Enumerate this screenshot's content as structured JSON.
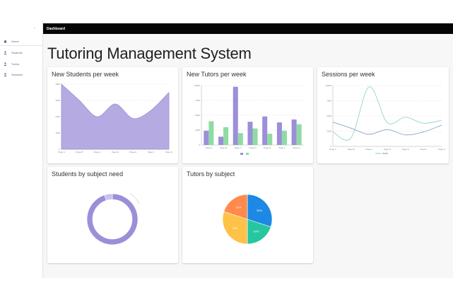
{
  "sidebar": {
    "collapse_icon": "chevron-left-icon",
    "items": [
      {
        "label": "Home",
        "icon": "home-icon"
      },
      {
        "label": "Students",
        "icon": "person-icon"
      },
      {
        "label": "Tutors",
        "icon": "person-icon"
      },
      {
        "label": "Sessions",
        "icon": "person-icon"
      }
    ]
  },
  "appbar": {
    "title": "Dashboard"
  },
  "page": {
    "title": "Tutoring Management System"
  },
  "colors": {
    "purple": "#9c8fd8",
    "green": "#8fdba3",
    "blue_line": "#7b92c8",
    "teal_line": "#8ad0c0"
  },
  "cards": {
    "new_students": {
      "title": "New Students per week"
    },
    "new_tutors": {
      "title": "New Tutors per week"
    },
    "sessions": {
      "title": "Sessions per week"
    },
    "students_by_subject": {
      "title": "Students by subject need"
    },
    "tutors_by_subject": {
      "title": "Tutors by subject"
    }
  },
  "chart_data": [
    {
      "type": "area",
      "title": "New Students per week",
      "x": [
        "Page A",
        "Page B",
        "Page C",
        "Page D",
        "Page E",
        "Page F",
        "Page G"
      ],
      "y_ticks": [
        "0",
        "1000",
        "2000",
        "3000",
        "4000"
      ],
      "ylim": [
        0,
        4000
      ],
      "series": [
        {
          "values": [
            4000,
            3000,
            2000,
            2780,
            1890,
            2390,
            3490
          ]
        }
      ],
      "grid": true
    },
    {
      "type": "bar",
      "title": "New Tutors per week",
      "categories": [
        "Page A",
        "Page B",
        "Page C",
        "Page D",
        "Page E",
        "Page F",
        "Page G"
      ],
      "y_ticks": [
        "0",
        "2500",
        "5000",
        "7500",
        "10000"
      ],
      "ylim": [
        0,
        10000
      ],
      "series": [
        {
          "values": [
            2400,
            1398,
            9800,
            3908,
            4800,
            3800,
            4300
          ]
        },
        {
          "values": [
            4000,
            3000,
            2000,
            2780,
            1890,
            2390,
            3490
          ]
        }
      ],
      "legend_position": "bottom",
      "grid": true
    },
    {
      "type": "line",
      "title": "Sessions per week",
      "x": [
        "Page A",
        "Page B",
        "Page C",
        "Page D",
        "Page E",
        "Page F",
        "Page G"
      ],
      "y_ticks": [
        "0",
        "2500",
        "5000",
        "7500",
        "10000"
      ],
      "ylim": [
        0,
        10000
      ],
      "series": [
        {
          "values": [
            4000,
            3000,
            2000,
            2780,
            1890,
            2390,
            3490
          ]
        },
        {
          "values": [
            2400,
            1398,
            9800,
            3908,
            4800,
            3800,
            4300
          ]
        }
      ],
      "legend_position": "bottom",
      "grid": true
    },
    {
      "type": "pie",
      "title": "Students by subject need",
      "series": [
        {
          "values": [
            95,
            5
          ]
        }
      ],
      "style": "donut"
    },
    {
      "type": "pie",
      "title": "Tutors by subject",
      "series": [
        {
          "values": [
            30,
            20,
            30,
            20
          ]
        }
      ],
      "slice_labels": [
        "30%",
        "20%",
        "30%",
        "20%"
      ],
      "slice_colors": [
        "#1e88e5",
        "#26c6a1",
        "#ffc148",
        "#ff8a4c"
      ]
    }
  ]
}
